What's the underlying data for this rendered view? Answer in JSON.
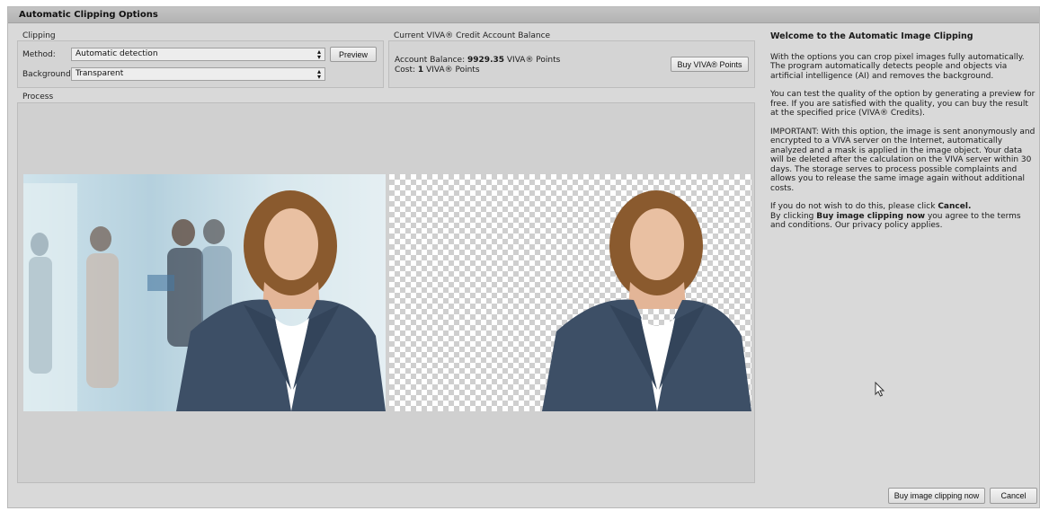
{
  "window": {
    "title": "Automatic Clipping Options"
  },
  "clipping": {
    "group_label": "Clipping",
    "method_label": "Method:",
    "method_value": "Automatic detection",
    "background_label": "Background:",
    "background_value": "Transparent",
    "preview_label": "Preview"
  },
  "balance": {
    "group_label": "Current VIVA® Credit Account Balance",
    "account_prefix": "Account Balance:",
    "account_value": "9929.35",
    "account_suffix": "VIVA® Points",
    "cost_prefix": "Cost:",
    "cost_value": "1",
    "cost_suffix": "VIVA® Points",
    "buy_points_label": "Buy VIVA® Points"
  },
  "process": {
    "label": "Process"
  },
  "sidebar": {
    "heading": "Welcome to the Automatic Image Clipping",
    "para1": "With the options you can crop pixel images fully automatically. The program automatically detects people and objects via artificial intelligence (AI) and removes the background.",
    "para2": "You can test the quality of the option by generating a preview for free. If you are satisfied with the quality, you can buy the result at the specified price (VIVA® Credits).",
    "para3": "IMPORTANT: With this option, the image is sent anonymously and encrypted to a VIVA server on the Internet, automatically analyzed and a mask is applied in the image object. Your data will be deleted after the calculation on the VIVA server within 30 days. The storage serves to process possible complaints and allows you to release the same image again without additional costs.",
    "para4_a": "If you do not wish to do this, please click ",
    "para4_b": "Cancel.",
    "para4_c": "By clicking ",
    "para4_d": "Buy image clipping now",
    "para4_e": " you agree to the terms and conditions. Our privacy policy applies."
  },
  "footer": {
    "buy_label": "Buy image clipping now",
    "cancel_label": "Cancel"
  },
  "colors": {
    "window_bg": "#d9d9d9",
    "titlebar": "#b8b8b8",
    "jacket": "#3d4f66",
    "hair": "#8a5a2e"
  },
  "icons": {
    "select_arrows": "up-down-arrows-icon",
    "cursor": "mouse-pointer-icon"
  }
}
